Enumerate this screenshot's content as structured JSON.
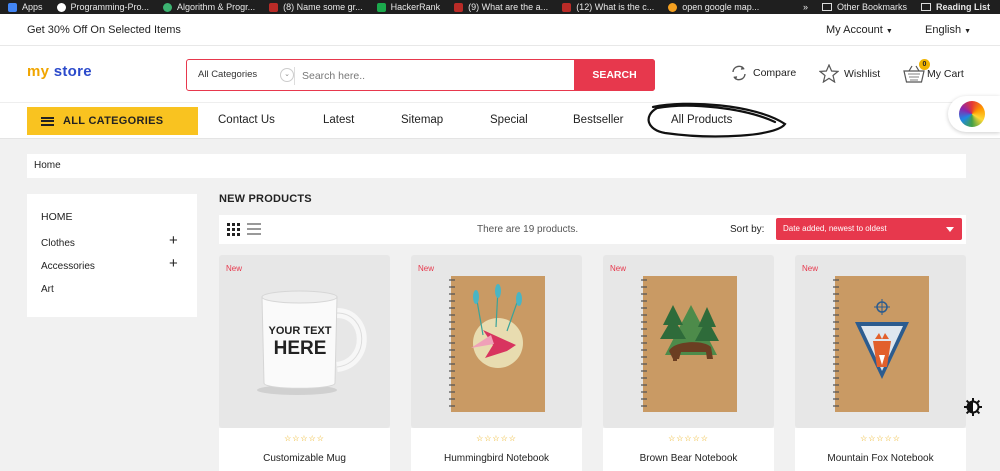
{
  "bookmarks": {
    "items": [
      "Apps",
      "Programming-Pro...",
      "Algorithm & Progr...",
      "(8) Name some gr...",
      "HackerRank",
      "(9) What are the a...",
      "(12) What is the c...",
      "open google map..."
    ],
    "more": "»",
    "other": "Other Bookmarks",
    "reading": "Reading List"
  },
  "topbar": {
    "promo": "Get 30% Off On Selected Items",
    "account": "My Account",
    "language": "English"
  },
  "header": {
    "logo_my": "my",
    "logo_store": "store",
    "category": "All Categories",
    "search_placeholder": "Search here..",
    "search_button": "SEARCH",
    "compare": "Compare",
    "wishlist": "Wishlist",
    "cart": "My Cart",
    "cart_count": "0"
  },
  "nav": {
    "all_categories": "ALL CATEGORIES",
    "items": [
      "Contact Us",
      "Latest",
      "Sitemap",
      "Special",
      "Bestseller",
      "All Products"
    ]
  },
  "breadcrumb": "Home",
  "sidebar": {
    "items": [
      "HOME",
      "Clothes",
      "Accessories",
      "Art"
    ]
  },
  "main": {
    "title": "NEW PRODUCTS",
    "count": "There are 19 products.",
    "sort_label": "Sort by:",
    "sort_value": "Date added, newest to oldest",
    "tag": "New",
    "products": [
      {
        "name": "Customizable Mug",
        "mug_text_1": "YOUR TEXT",
        "mug_text_2": "HERE"
      },
      {
        "name": "Hummingbird Notebook"
      },
      {
        "name": "Brown Bear Notebook"
      },
      {
        "name": "Mountain Fox Notebook"
      }
    ]
  },
  "colors": {
    "accent_red": "#e7384d",
    "accent_yellow": "#f9c320",
    "background": "#f1f1f1"
  }
}
